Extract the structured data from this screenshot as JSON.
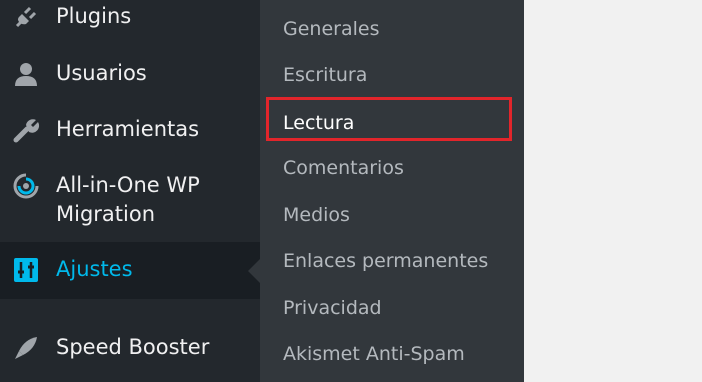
{
  "menu": {
    "items": [
      {
        "label": "Plugins",
        "icon": "plugin-icon"
      },
      {
        "label": "Usuarios",
        "icon": "user-icon"
      },
      {
        "label": "Herramientas",
        "icon": "wrench-icon"
      },
      {
        "label": "All-in-One WP Migration",
        "icon": "migration-icon"
      },
      {
        "label": "Ajustes",
        "icon": "settings-icon",
        "active": true
      },
      {
        "label": "Speed Booster",
        "icon": "rocket-icon"
      }
    ]
  },
  "submenu": {
    "items": [
      {
        "label": "Generales"
      },
      {
        "label": "Escritura"
      },
      {
        "label": "Lectura",
        "highlighted": true
      },
      {
        "label": "Comentarios"
      },
      {
        "label": "Medios"
      },
      {
        "label": "Enlaces permanentes"
      },
      {
        "label": "Privacidad"
      },
      {
        "label": "Akismet Anti-Spam"
      }
    ]
  },
  "colors": {
    "sidebar_bg": "#23282d",
    "submenu_bg": "#32373c",
    "active_bg": "#191e23",
    "accent": "#00b9eb",
    "highlight": "#e2252b"
  }
}
